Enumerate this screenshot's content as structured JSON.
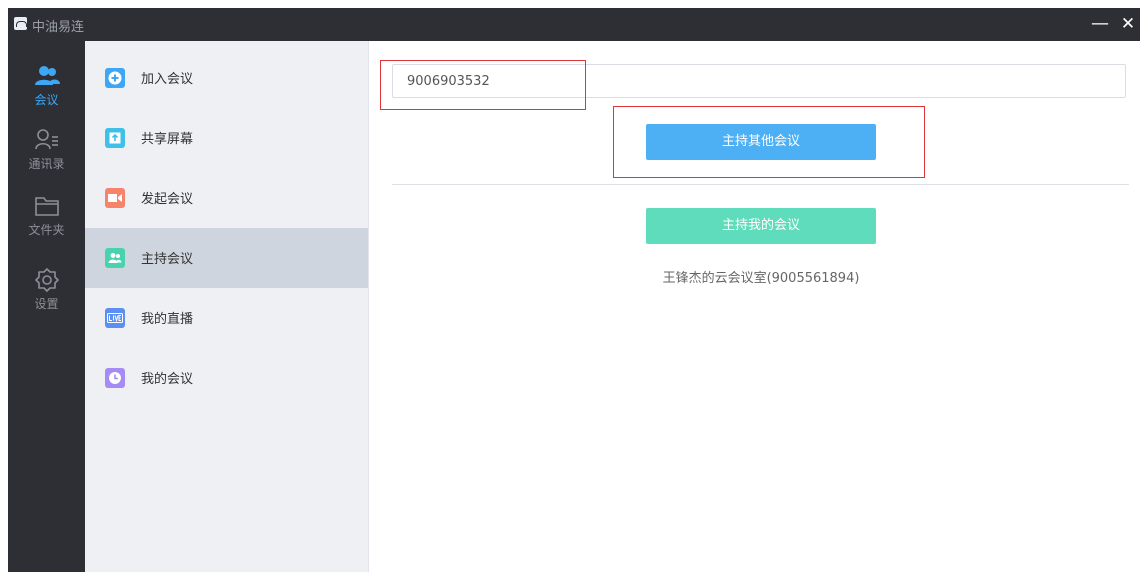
{
  "app": {
    "title": "中油易连"
  },
  "window_controls": {
    "minimize": "—",
    "close": "✕"
  },
  "rail": {
    "items": [
      {
        "label": "会议",
        "icon": "users-icon",
        "active": true
      },
      {
        "label": "通讯录",
        "icon": "contacts-icon",
        "active": false
      },
      {
        "label": "文件夹",
        "icon": "folder-icon",
        "active": false
      },
      {
        "label": "设置",
        "icon": "gear-icon",
        "active": false
      }
    ]
  },
  "menu": {
    "items": [
      {
        "label": "加入会议",
        "icon": "plus-circle-icon",
        "color": "#3ea7f5",
        "active": false
      },
      {
        "label": "共享屏幕",
        "icon": "share-up-icon",
        "color": "#3fc0e8",
        "active": false
      },
      {
        "label": "发起会议",
        "icon": "video-camera-icon",
        "color": "#f5846a",
        "active": false
      },
      {
        "label": "主持会议",
        "icon": "host-users-icon",
        "color": "#48d3ae",
        "active": true
      },
      {
        "label": "我的直播",
        "icon": "live-icon",
        "color": "#5b8ff3",
        "active": false
      },
      {
        "label": "我的会议",
        "icon": "clock-icon",
        "color": "#a78bf5",
        "active": false
      }
    ]
  },
  "main": {
    "meeting_id_value": "9006903532",
    "host_other_label": "主持其他会议",
    "host_mine_label": "主持我的会议",
    "room_text": "王锋杰的云会议室(9005561894)"
  },
  "colors": {
    "accent": "#3ea7f5",
    "teal": "#5fdcbb",
    "highlight": "#e0343a"
  }
}
